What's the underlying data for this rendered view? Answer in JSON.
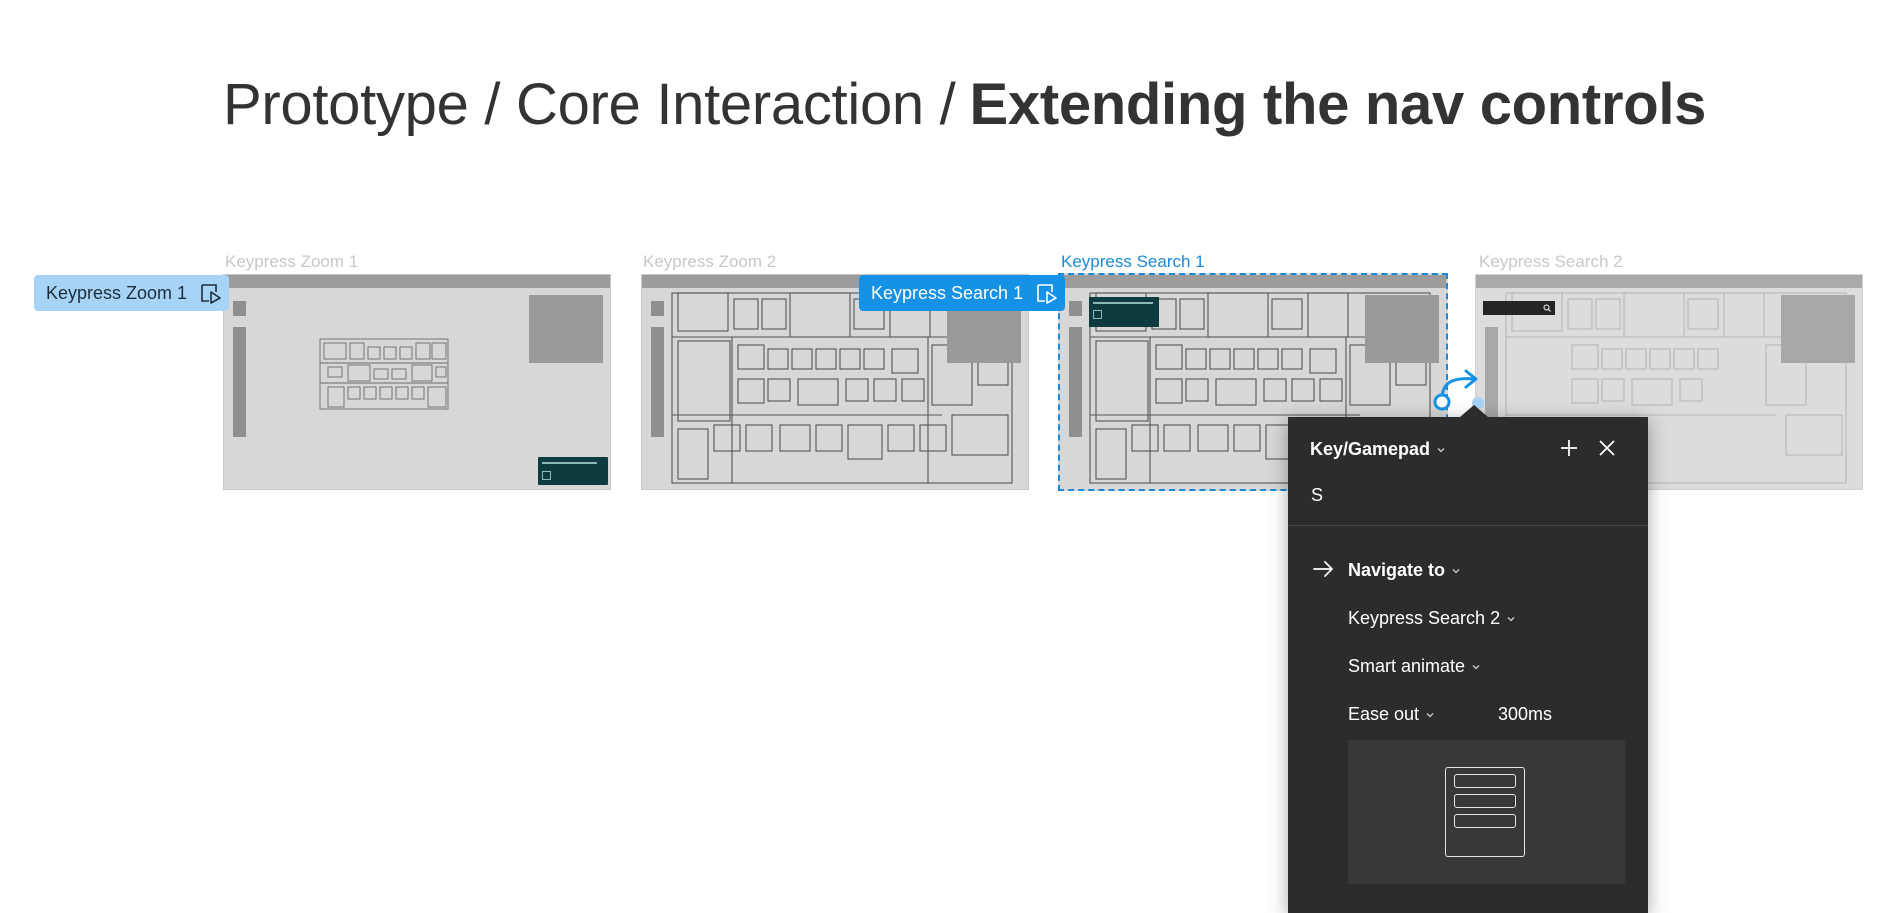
{
  "breadcrumb": {
    "part1": "Prototype / Core Interaction /",
    "current": "Extending the nav controls"
  },
  "frames": [
    {
      "label": "Keypress Zoom 1"
    },
    {
      "label": "Keypress Zoom 2"
    },
    {
      "label": "Keypress Search 1"
    },
    {
      "label": "Keypress Search 2"
    }
  ],
  "tags": {
    "zoom": "Keypress Zoom 1",
    "search": "Keypress Search 1"
  },
  "interaction_panel": {
    "trigger": "Key/Gamepad",
    "key": "S",
    "action": "Navigate to",
    "destination": "Keypress Search 2",
    "animation": "Smart animate",
    "easing": "Ease out",
    "duration": "300ms"
  },
  "colors": {
    "accent": "#1592e6",
    "panel_bg": "#2c2c2c",
    "frame_bg": "#d7d7d7"
  },
  "icons": [
    "play-frame-icon",
    "connection-arrow-icon",
    "chevron-down-icon",
    "plus-icon",
    "close-icon",
    "arrow-right-icon"
  ]
}
